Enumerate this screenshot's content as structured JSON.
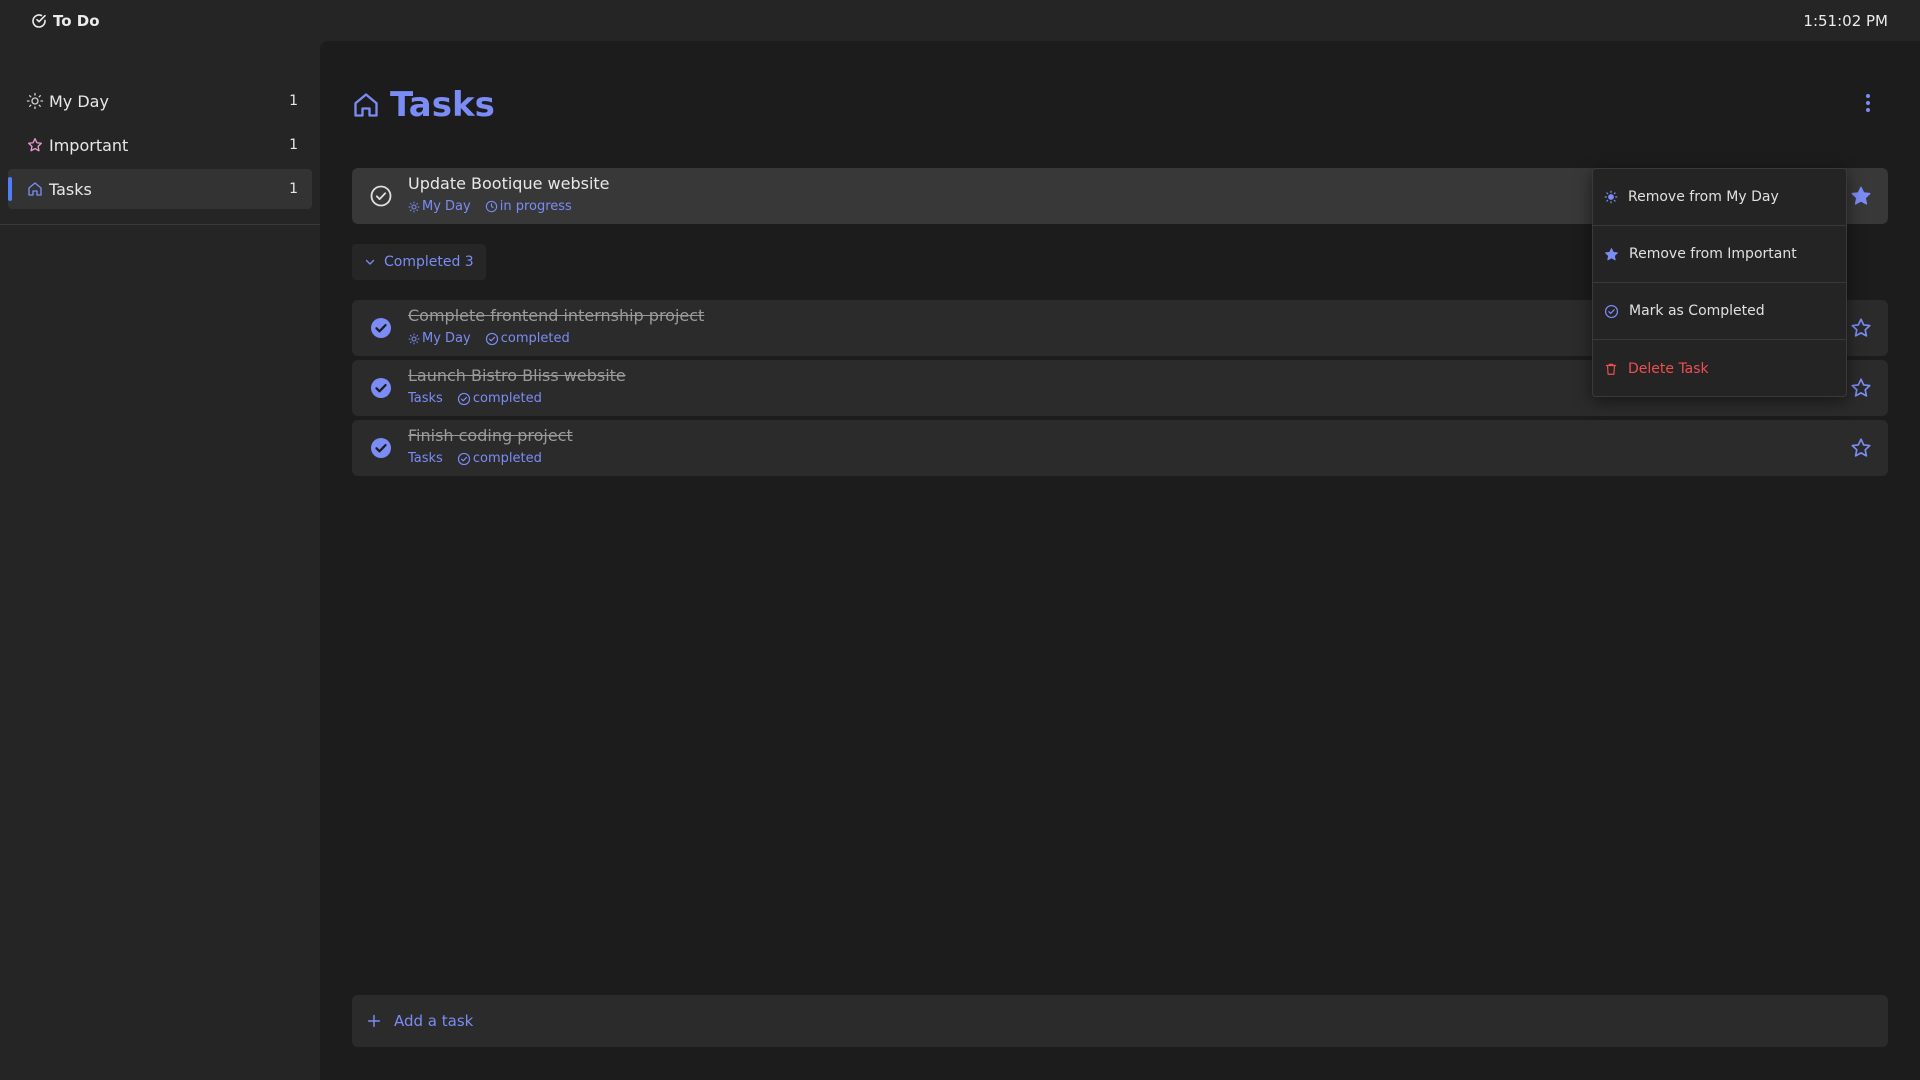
{
  "app": {
    "title": "To Do",
    "clock": "1:51:02 PM"
  },
  "colors": {
    "accent": "#7b8cf5",
    "active_bar": "#4f7ff7",
    "danger": "#ef4f4f"
  },
  "sidebar": {
    "items": [
      {
        "label": "My Day",
        "count": "1",
        "icon": "sun-icon"
      },
      {
        "label": "Important",
        "count": "1",
        "icon": "star-icon"
      },
      {
        "label": "Tasks",
        "count": "1",
        "icon": "home-icon",
        "active": true
      }
    ]
  },
  "main": {
    "title": "Tasks",
    "title_icon": "home-icon",
    "active_tasks": [
      {
        "title": "Update Bootique website",
        "list": "My Day",
        "status": "in progress",
        "important": true,
        "completed": false
      }
    ],
    "completed_section": {
      "label": "Completed 3"
    },
    "completed_tasks": [
      {
        "title": "Complete frontend internship project",
        "list": "My Day",
        "status": "completed",
        "important": false
      },
      {
        "title": "Launch Bistro Bliss website",
        "list": "Tasks",
        "status": "completed",
        "important": false
      },
      {
        "title": "Finish coding project",
        "list": "Tasks",
        "status": "completed",
        "important": false
      }
    ],
    "add_task": {
      "label": "Add a task"
    }
  },
  "context_menu": {
    "items": [
      {
        "label": "Remove from My Day",
        "icon": "sun-icon"
      },
      {
        "label": "Remove from Important",
        "icon": "star-filled-icon"
      },
      {
        "label": "Mark as Completed",
        "icon": "check-circle-icon"
      },
      {
        "label": "Delete Task",
        "icon": "trash-icon",
        "danger": true
      }
    ]
  }
}
